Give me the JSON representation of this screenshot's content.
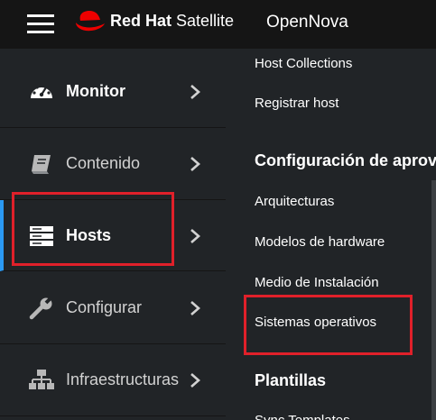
{
  "header": {
    "brand_name": "Red Hat",
    "brand_product": "Satellite",
    "organization": "OpenNova",
    "menu_icon": "hamburger-menu-icon",
    "logo_icon": "red-hat-icon"
  },
  "sidebar": {
    "items": [
      {
        "label": "Monitor",
        "icon": "dashboard-gauge-icon",
        "active": false
      },
      {
        "label": "Contenido",
        "icon": "book-icon",
        "active": false
      },
      {
        "label": "Hosts",
        "icon": "server-icon",
        "active": true
      },
      {
        "label": "Configurar",
        "icon": "wrench-icon",
        "active": false
      },
      {
        "label": "Infraestructuras",
        "icon": "network-icon",
        "active": false
      }
    ]
  },
  "flyout": {
    "items": [
      {
        "label": "Host Collections"
      },
      {
        "label": "Registrar host"
      },
      {
        "label": "Configuración de aprovisionamiento"
      },
      {
        "label": "Arquitecturas"
      },
      {
        "label": "Modelos de hardware"
      },
      {
        "label": "Medio de Instalación"
      },
      {
        "label": "Sistemas operativos"
      },
      {
        "label": "Plantillas"
      },
      {
        "label": "Sync Templates"
      }
    ]
  },
  "colors": {
    "topbar": "#151515",
    "sidebar": "#212427",
    "active_indicator": "#2b9af3",
    "highlight": "#e0202a"
  }
}
